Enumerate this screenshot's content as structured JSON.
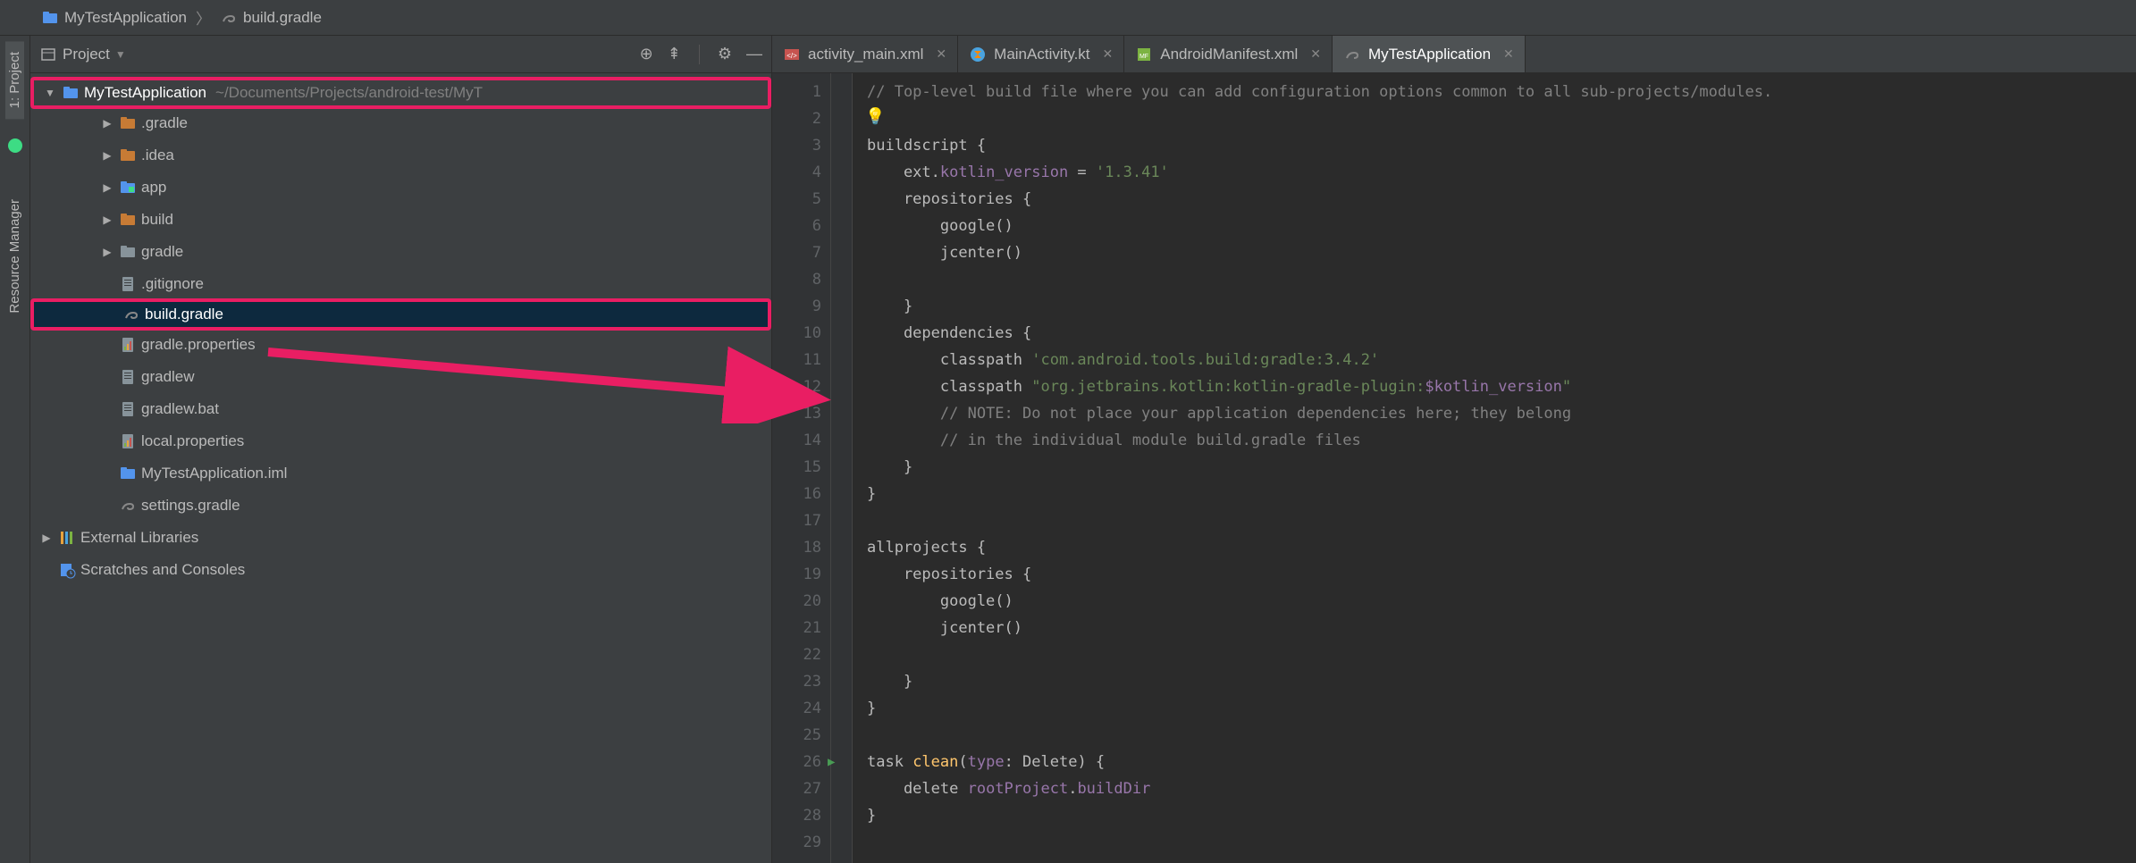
{
  "breadcrumb": {
    "root": "MyTestApplication",
    "file": "build.gradle"
  },
  "leftRail": {
    "projectTab": "1: Project",
    "resourceTab": "Resource Manager"
  },
  "projectPanel": {
    "title": "Project",
    "projectName": "MyTestApplication",
    "projectPath": "~/Documents/Projects/android-test/MyT",
    "items": [
      {
        "label": ".gradle",
        "kind": "folder-orange",
        "indent": 2,
        "arrow": "right"
      },
      {
        "label": ".idea",
        "kind": "folder-orange",
        "indent": 2,
        "arrow": "right"
      },
      {
        "label": "app",
        "kind": "folder-module",
        "indent": 2,
        "arrow": "right"
      },
      {
        "label": "build",
        "kind": "folder-orange",
        "indent": 2,
        "arrow": "right"
      },
      {
        "label": "gradle",
        "kind": "folder",
        "indent": 2,
        "arrow": "right"
      },
      {
        "label": ".gitignore",
        "kind": "file",
        "indent": 2
      },
      {
        "label": "build.gradle",
        "kind": "gradle",
        "indent": 2,
        "selected": true,
        "highlighted": true
      },
      {
        "label": "gradle.properties",
        "kind": "props",
        "indent": 2
      },
      {
        "label": "gradlew",
        "kind": "file",
        "indent": 2
      },
      {
        "label": "gradlew.bat",
        "kind": "file",
        "indent": 2
      },
      {
        "label": "local.properties",
        "kind": "props",
        "indent": 2
      },
      {
        "label": "MyTestApplication.iml",
        "kind": "module",
        "indent": 2
      },
      {
        "label": "settings.gradle",
        "kind": "gradle",
        "indent": 2
      }
    ],
    "externalLibs": "External Libraries",
    "scratches": "Scratches and Consoles"
  },
  "tabs": [
    {
      "label": "activity_main.xml",
      "kind": "xml"
    },
    {
      "label": "MainActivity.kt",
      "kind": "kt"
    },
    {
      "label": "AndroidManifest.xml",
      "kind": "manifest"
    },
    {
      "label": "MyTestApplication",
      "kind": "gradle",
      "active": true
    }
  ],
  "code": {
    "lines": [
      {
        "n": 1,
        "seg": [
          [
            "comment",
            "// Top-level build file where you can add configuration options common to all sub-projects/modules."
          ]
        ]
      },
      {
        "n": 2,
        "seg": []
      },
      {
        "n": 3,
        "seg": [
          [
            "plain",
            "buildscript "
          ],
          [
            "plain",
            "{"
          ]
        ]
      },
      {
        "n": 4,
        "seg": [
          [
            "plain",
            "    ext."
          ],
          [
            "ident",
            "kotlin_version"
          ],
          [
            "plain",
            " = "
          ],
          [
            "string",
            "'1.3.41'"
          ]
        ]
      },
      {
        "n": 5,
        "seg": [
          [
            "plain",
            "    repositories "
          ],
          [
            "plain",
            "{"
          ]
        ]
      },
      {
        "n": 6,
        "seg": [
          [
            "plain",
            "        google()"
          ]
        ]
      },
      {
        "n": 7,
        "seg": [
          [
            "plain",
            "        jcenter()"
          ]
        ]
      },
      {
        "n": 8,
        "seg": []
      },
      {
        "n": 9,
        "seg": [
          [
            "plain",
            "    }"
          ]
        ]
      },
      {
        "n": 10,
        "seg": [
          [
            "plain",
            "    dependencies "
          ],
          [
            "plain",
            "{"
          ]
        ]
      },
      {
        "n": 11,
        "seg": [
          [
            "plain",
            "        classpath "
          ],
          [
            "string",
            "'com.android.tools.build:gradle:3.4.2'"
          ]
        ]
      },
      {
        "n": 12,
        "seg": [
          [
            "plain",
            "        classpath "
          ],
          [
            "string",
            "\"org.jetbrains.kotlin:kotlin-gradle-plugin:"
          ],
          [
            "ident",
            "$kotlin_version"
          ],
          [
            "string",
            "\""
          ]
        ]
      },
      {
        "n": 13,
        "seg": [
          [
            "plain",
            "        "
          ],
          [
            "comment",
            "// NOTE: Do not place your application dependencies here; they belong"
          ]
        ]
      },
      {
        "n": 14,
        "seg": [
          [
            "plain",
            "        "
          ],
          [
            "comment",
            "// in the individual module build.gradle files"
          ]
        ]
      },
      {
        "n": 15,
        "seg": [
          [
            "plain",
            "    }"
          ]
        ]
      },
      {
        "n": 16,
        "seg": [
          [
            "plain",
            "}"
          ]
        ]
      },
      {
        "n": 17,
        "seg": []
      },
      {
        "n": 18,
        "seg": [
          [
            "plain",
            "allprojects "
          ],
          [
            "plain",
            "{"
          ]
        ]
      },
      {
        "n": 19,
        "seg": [
          [
            "plain",
            "    repositories "
          ],
          [
            "plain",
            "{"
          ]
        ]
      },
      {
        "n": 20,
        "seg": [
          [
            "plain",
            "        google()"
          ]
        ]
      },
      {
        "n": 21,
        "seg": [
          [
            "plain",
            "        jcenter()"
          ]
        ]
      },
      {
        "n": 22,
        "seg": []
      },
      {
        "n": 23,
        "seg": [
          [
            "plain",
            "    }"
          ]
        ]
      },
      {
        "n": 24,
        "seg": [
          [
            "plain",
            "}"
          ]
        ]
      },
      {
        "n": 25,
        "seg": []
      },
      {
        "n": 26,
        "seg": [
          [
            "plain",
            "task "
          ],
          [
            "func",
            "clean"
          ],
          [
            "plain",
            "("
          ],
          [
            "ident",
            "type"
          ],
          [
            "plain",
            ": Delete) "
          ],
          [
            "plain",
            "{"
          ]
        ],
        "run": true
      },
      {
        "n": 27,
        "seg": [
          [
            "plain",
            "    delete "
          ],
          [
            "ident",
            "rootProject"
          ],
          [
            "plain",
            "."
          ],
          [
            "ident",
            "buildDir"
          ]
        ]
      },
      {
        "n": 28,
        "seg": [
          [
            "plain",
            "}"
          ]
        ]
      },
      {
        "n": 29,
        "seg": []
      }
    ]
  }
}
